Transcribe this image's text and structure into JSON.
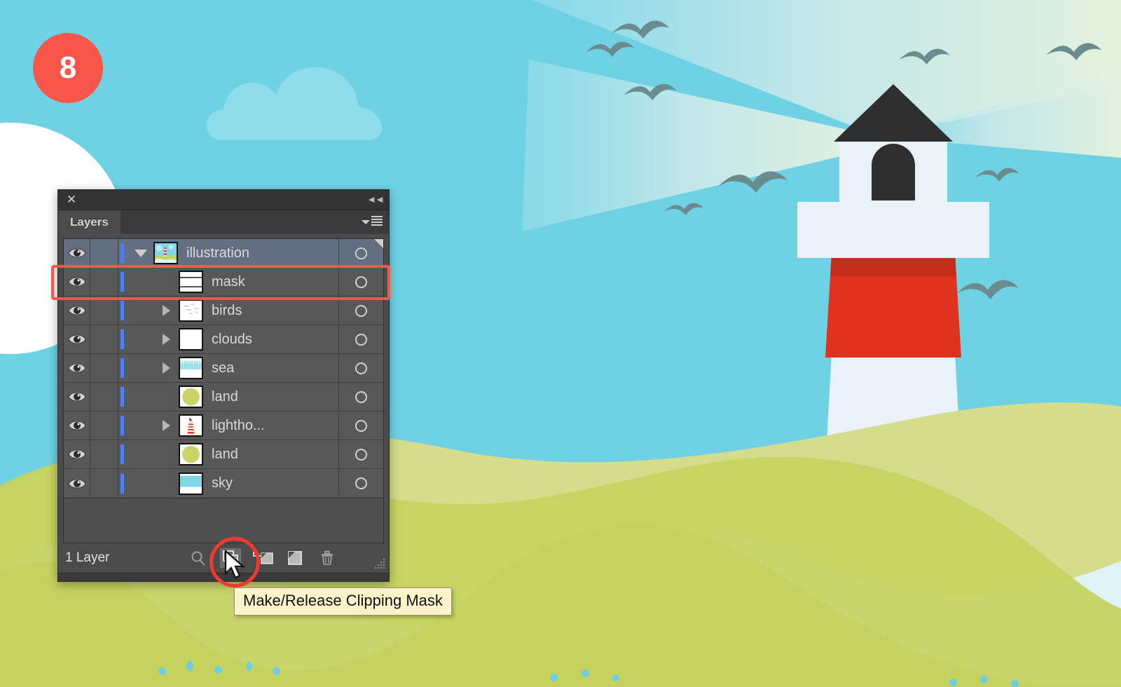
{
  "badge": {
    "step": "8"
  },
  "panel": {
    "title": "Layers",
    "close_icon": "close-icon",
    "collapse_icon": "collapse-double-chevron-icon",
    "menu_icon": "panel-menu-icon",
    "footer": {
      "layer_count": "1 Layer",
      "buttons": [
        {
          "name": "locate-object-button",
          "icon": "magnifier-icon",
          "label": "Locate Object",
          "active": false
        },
        {
          "name": "make-release-clipping-mask-button",
          "icon": "clipping-mask-icon",
          "label": "Make/Release Clipping Mask",
          "active": true
        },
        {
          "name": "create-new-sublayer-button",
          "icon": "new-sublayer-icon",
          "label": "Create New Sublayer",
          "active": false
        },
        {
          "name": "create-new-layer-button",
          "icon": "new-layer-icon",
          "label": "Create New Layer",
          "active": false
        },
        {
          "name": "delete-selection-button",
          "icon": "trash-icon",
          "label": "Delete Selection",
          "active": false
        }
      ],
      "resize_grip_icon": "resize-grip-icon"
    },
    "rows": [
      {
        "name": "illustration",
        "indent": 0,
        "selected": true,
        "disclosure": "down",
        "thumb": "illustration",
        "visible": true,
        "target_flag": true
      },
      {
        "name": "mask",
        "indent": 1,
        "selected": false,
        "disclosure": "none",
        "thumb": "mask",
        "visible": true,
        "target_flag": false
      },
      {
        "name": "birds",
        "indent": 1,
        "selected": false,
        "disclosure": "right",
        "thumb": "birds",
        "visible": true,
        "target_flag": false
      },
      {
        "name": "clouds",
        "indent": 1,
        "selected": false,
        "disclosure": "right",
        "thumb": "clouds",
        "visible": true,
        "target_flag": false
      },
      {
        "name": "sea",
        "indent": 1,
        "selected": false,
        "disclosure": "right",
        "thumb": "sea",
        "visible": true,
        "target_flag": false
      },
      {
        "name": "land",
        "indent": 1,
        "selected": false,
        "disclosure": "none",
        "thumb": "land",
        "visible": true,
        "target_flag": false
      },
      {
        "name": "lightho...",
        "indent": 1,
        "selected": false,
        "disclosure": "right",
        "thumb": "lighthouse",
        "visible": true,
        "target_flag": false
      },
      {
        "name": "land",
        "indent": 1,
        "selected": false,
        "disclosure": "none",
        "thumb": "land",
        "visible": true,
        "target_flag": false
      },
      {
        "name": "sky",
        "indent": 1,
        "selected": false,
        "disclosure": "none",
        "thumb": "sky",
        "visible": true,
        "target_flag": false
      }
    ]
  },
  "tooltip": {
    "text": "Make/Release Clipping Mask"
  },
  "annotations": {
    "row_highlight_label": "mask-row-highlight",
    "button_highlight_label": "clipping-mask-button-highlight",
    "highlight_color": "#f8564a"
  },
  "cursor": {
    "icon": "arrow-cursor"
  },
  "artwork": {
    "title": "lighthouse-seascape-illustration",
    "colors": {
      "sky": "#6ed2e4",
      "cloud": "#8fdceb",
      "sun": "#ffffff",
      "beam": "#dff0e0",
      "land_back": "#d5dd8c",
      "land_front": "#c6d25e",
      "water": "#e0f3f7",
      "lighthouse_body": "#e9f2f8",
      "lighthouse_red": "#e0331d",
      "lighthouse_red_dark": "#c32c1a",
      "lighthouse_roof": "#2f2f2f",
      "bird": "#6a8c91",
      "foam_dot": "#6fcde0"
    },
    "elements": [
      "sun",
      "cloud",
      "light-beam",
      "birds",
      "lighthouse",
      "land",
      "water",
      "foam-dots"
    ]
  }
}
